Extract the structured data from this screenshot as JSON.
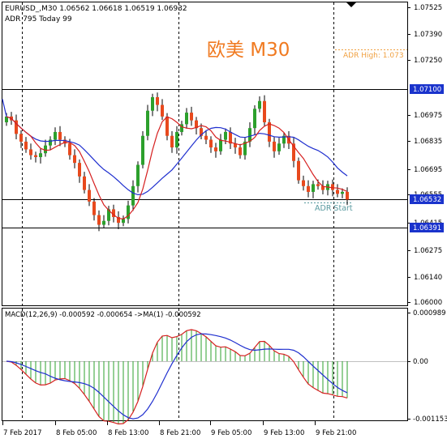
{
  "header": {
    "symbol_line": "EURUSD_,M30  1.06562 1.06618 1.06519 1.06932",
    "indicator_line": "ADR 795  Today 99",
    "overlay_title": "欧美 M30"
  },
  "annotations": {
    "adr_high": "ADR High: 1.073",
    "adr_start": "ADR Start"
  },
  "price_axis": {
    "labels": [
      "1.07525",
      "1.07390",
      "1.07250",
      "1.06975",
      "1.06835",
      "1.06695",
      "1.06555",
      "1.06415",
      "1.06275",
      "1.06140",
      "1.06000"
    ],
    "highlight_labels": [
      "1.07100",
      "1.06532",
      "1.06391"
    ]
  },
  "macd": {
    "label": "MACD(12,26,9) -0.000592 -0.000654  ->MA(1) -0.000592",
    "axis_labels": [
      "0.000989",
      "0.00",
      "-0.001153"
    ]
  },
  "time_axis": {
    "labels": [
      "7 Feb 2017",
      "8 Feb 05:00",
      "8 Feb 13:00",
      "8 Feb 21:00",
      "9 Feb 05:00",
      "9 Feb 13:00",
      "9 Feb 21:00"
    ]
  },
  "colors": {
    "bull_candle": "#2ca02c",
    "bear_candle": "#e8491d",
    "ma_fast": "#d62020",
    "ma_slow": "#1f2fcf",
    "macd_hist": "#2ca02c",
    "macd_signal": "#d62020",
    "macd_line": "#1f2fcf",
    "overlay_title": "#f07a20",
    "adr_high": "#f0a040",
    "adr_start": "#5a9aa0",
    "highlight_label_bg": "#1a33cc"
  },
  "chart_data": {
    "type": "candlestick",
    "timeframe": "M30",
    "price_range": [
      1.06,
      1.07525
    ],
    "horizontal_levels": [
      1.071,
      1.06532,
      1.06391
    ],
    "adr_high_level": 1.073,
    "closes": [
      1.0696,
      1.0694,
      1.0687,
      1.0683,
      1.0679,
      1.0676,
      1.0675,
      1.0677,
      1.0681,
      1.0684,
      1.0688,
      1.0684,
      1.0682,
      1.0676,
      1.0672,
      1.0665,
      1.0658,
      1.0652,
      1.0645,
      1.064,
      1.0642,
      1.0648,
      1.0644,
      1.0641,
      1.0643,
      1.065,
      1.066,
      1.0671,
      1.0686,
      1.0699,
      1.0706,
      1.0702,
      1.0696,
      1.0686,
      1.068,
      1.0688,
      1.0692,
      1.0698,
      1.0694,
      1.069,
      1.0686,
      1.0684,
      1.068,
      1.0678,
      1.0684,
      1.0688,
      1.0682,
      1.068,
      1.0676,
      1.0683,
      1.069,
      1.07,
      1.0704,
      1.0693,
      1.0683,
      1.0678,
      1.0682,
      1.0686,
      1.0682,
      1.0673,
      1.0663,
      1.066,
      1.0657,
      1.0661,
      1.066,
      1.0658,
      1.0661,
      1.0658,
      1.0656,
      1.0657,
      1.0653
    ]
  }
}
